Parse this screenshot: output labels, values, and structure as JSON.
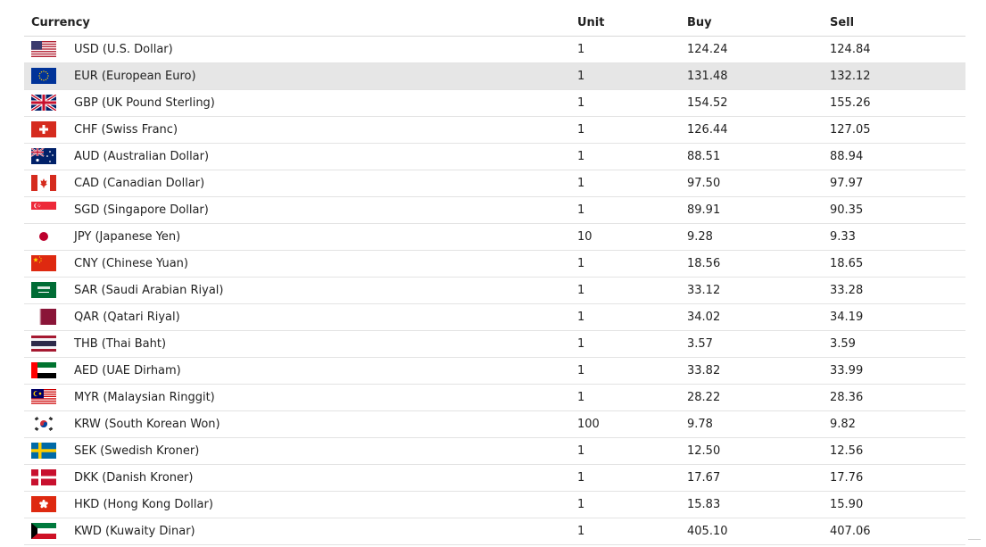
{
  "table": {
    "headers": {
      "currency": "Currency",
      "unit": "Unit",
      "buy": "Buy",
      "sell": "Sell"
    },
    "rows": [
      {
        "flag": "flag-us-icon",
        "name": "USD (U.S. Dollar)",
        "unit": "1",
        "buy": "124.24",
        "sell": "124.84",
        "highlighted": false
      },
      {
        "flag": "flag-eu-icon",
        "name": "EUR (European Euro)",
        "unit": "1",
        "buy": "131.48",
        "sell": "132.12",
        "highlighted": true
      },
      {
        "flag": "flag-gb-icon",
        "name": "GBP (UK Pound Sterling)",
        "unit": "1",
        "buy": "154.52",
        "sell": "155.26",
        "highlighted": false
      },
      {
        "flag": "flag-ch-icon",
        "name": "CHF (Swiss Franc)",
        "unit": "1",
        "buy": "126.44",
        "sell": "127.05",
        "highlighted": false
      },
      {
        "flag": "flag-au-icon",
        "name": "AUD (Australian Dollar)",
        "unit": "1",
        "buy": "88.51",
        "sell": "88.94",
        "highlighted": false
      },
      {
        "flag": "flag-ca-icon",
        "name": "CAD (Canadian Dollar)",
        "unit": "1",
        "buy": "97.50",
        "sell": "97.97",
        "highlighted": false
      },
      {
        "flag": "flag-sg-icon",
        "name": "SGD (Singapore Dollar)",
        "unit": "1",
        "buy": "89.91",
        "sell": "90.35",
        "highlighted": false
      },
      {
        "flag": "flag-jp-icon",
        "name": "JPY (Japanese Yen)",
        "unit": "10",
        "buy": "9.28",
        "sell": "9.33",
        "highlighted": false
      },
      {
        "flag": "flag-cn-icon",
        "name": "CNY (Chinese Yuan)",
        "unit": "1",
        "buy": "18.56",
        "sell": "18.65",
        "highlighted": false
      },
      {
        "flag": "flag-sa-icon",
        "name": "SAR (Saudi Arabian Riyal)",
        "unit": "1",
        "buy": "33.12",
        "sell": "33.28",
        "highlighted": false
      },
      {
        "flag": "flag-qa-icon",
        "name": "QAR (Qatari Riyal)",
        "unit": "1",
        "buy": "34.02",
        "sell": "34.19",
        "highlighted": false
      },
      {
        "flag": "flag-th-icon",
        "name": "THB (Thai Baht)",
        "unit": "1",
        "buy": "3.57",
        "sell": "3.59",
        "highlighted": false
      },
      {
        "flag": "flag-ae-icon",
        "name": "AED (UAE Dirham)",
        "unit": "1",
        "buy": "33.82",
        "sell": "33.99",
        "highlighted": false
      },
      {
        "flag": "flag-my-icon",
        "name": "MYR (Malaysian Ringgit)",
        "unit": "1",
        "buy": "28.22",
        "sell": "28.36",
        "highlighted": false
      },
      {
        "flag": "flag-kr-icon",
        "name": "KRW (South Korean Won)",
        "unit": "100",
        "buy": "9.78",
        "sell": "9.82",
        "highlighted": false
      },
      {
        "flag": "flag-se-icon",
        "name": "SEK (Swedish Kroner)",
        "unit": "1",
        "buy": "12.50",
        "sell": "12.56",
        "highlighted": false
      },
      {
        "flag": "flag-dk-icon",
        "name": "DKK (Danish Kroner)",
        "unit": "1",
        "buy": "17.67",
        "sell": "17.76",
        "highlighted": false
      },
      {
        "flag": "flag-hk-icon",
        "name": "HKD (Hong Kong Dollar)",
        "unit": "1",
        "buy": "15.83",
        "sell": "15.90",
        "highlighted": false
      },
      {
        "flag": "flag-kw-icon",
        "name": "KWD (Kuwaity Dinar)",
        "unit": "1",
        "buy": "405.10",
        "sell": "407.06",
        "highlighted": false
      }
    ]
  },
  "colors": {
    "row_highlight": "#e6e6e6",
    "row_border": "#e3e3e3",
    "text": "#222222"
  }
}
